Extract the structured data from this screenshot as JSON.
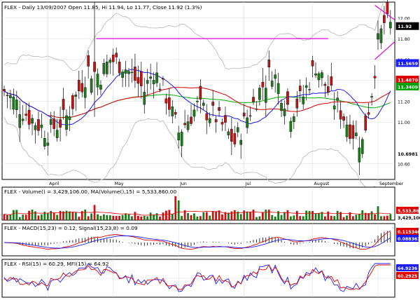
{
  "chart_data": [
    {
      "type": "candlestick",
      "title": "FLEX - Daily 13/09/2007 Open 11.85, Hi 11.94, Lo 11.77, Close 11.92 (1.3%)",
      "x_labels": [
        "April",
        "May",
        "Jun",
        "Jul",
        "August",
        "September"
      ],
      "y_ticks": [
        10.6,
        11.0,
        11.2,
        11.4,
        11.6,
        11.8,
        12.0
      ],
      "y_tick_labels": [
        "10.60",
        "11.00",
        "11.20",
        "11.40",
        "11.60",
        "11.80",
        "12.00"
      ],
      "ylim": [
        10.45,
        12.15
      ],
      "value_badges": [
        {
          "label": "11.9457",
          "value": 11.9457,
          "color": "#ffffff",
          "text_color": "#000000"
        },
        {
          "label": "11.92",
          "value": 11.92,
          "color": "#000000",
          "text_color": "#ffffff"
        },
        {
          "label": "11.5659",
          "value": 11.5659,
          "color": "#1a1aff",
          "text_color": "#ffffff"
        },
        {
          "label": "11.4070",
          "value": 11.407,
          "color": "#e00000",
          "text_color": "#ffffff"
        },
        {
          "label": "11.3409",
          "value": 11.3409,
          "color": "#00a000",
          "text_color": "#ffffff"
        },
        {
          "label": "10.6981",
          "value": 10.6981,
          "color": "#ffffff",
          "text_color": "#000000"
        }
      ],
      "annotations": {
        "resistance_line": {
          "value": 11.8,
          "from_index": 30,
          "to_index": 104,
          "color": "#e000e0"
        },
        "triangle_color": "#e000e0"
      },
      "colors": {
        "up": "#1c7c1c",
        "down": "#cc1111",
        "sma_short": "#1a1aff",
        "sma_mid": "#e00000",
        "sma_long": "#00b000",
        "bands": "#b4b4b4"
      }
    },
    {
      "type": "bar",
      "title": "FLEX - Volume() = 3,429,106.00, MA(Volume(),15) = 5,533,860.00",
      "value_badges": [
        {
          "label": "5,533,860",
          "color": "#e00000",
          "text_color": "#ffffff"
        },
        {
          "label": "3,429,106",
          "color": "#ffffff",
          "text_color": "#000000"
        }
      ],
      "colors": {
        "bars": "#1c7c1c",
        "ma": "#e00000"
      }
    },
    {
      "type": "line",
      "title": "FLEX - MACD(15,23) = 0.12, Signal(15,23,8) = 0.09",
      "series": [
        {
          "name": "MACD(15,23)"
        },
        {
          "name": "Signal(15,23,8)"
        }
      ],
      "value_badges": [
        {
          "label": "0.115346",
          "color": "#e00000",
          "text_color": "#ffffff"
        },
        {
          "label": "0.088361",
          "color": "#1a1aff",
          "text_color": "#ffffff"
        }
      ],
      "colors": {
        "macd": "#e00000",
        "signal": "#1a1aff",
        "hist": "#000000"
      }
    },
    {
      "type": "line",
      "title": "FLEX - RSI(15) = 60.29, MFI(15) = 64.92",
      "series": [
        {
          "name": "RSI(15)"
        },
        {
          "name": "MFI(15)"
        }
      ],
      "value_badges": [
        {
          "label": "64.9236",
          "color": "#1a1aff",
          "text_color": "#ffffff"
        },
        {
          "label": "60.2925",
          "color": "#e00000",
          "text_color": "#ffffff"
        }
      ],
      "colors": {
        "rsi": "#e00000",
        "mfi": "#1a1aff"
      }
    }
  ]
}
